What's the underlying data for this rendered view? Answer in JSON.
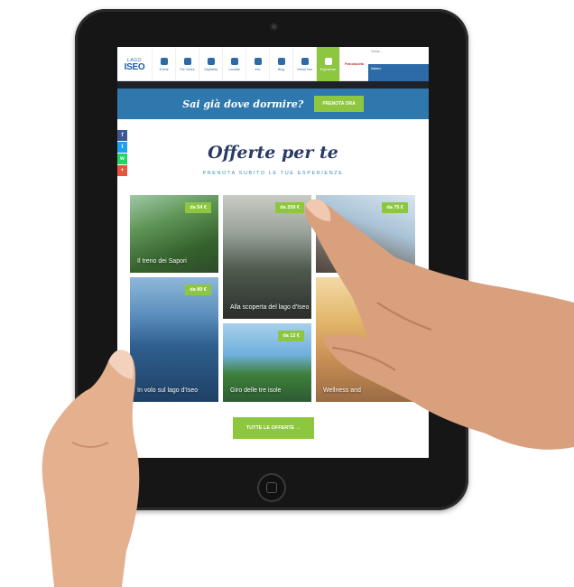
{
  "top_nav": {
    "logo_small": "LAGO",
    "logo_big": "ISEO",
    "items": [
      {
        "label": "Eventi",
        "icon": "calendar-icon"
      },
      {
        "label": "Per Vivere",
        "icon": "hotel-icon"
      },
      {
        "label": "Ospitalità",
        "icon": "bed-icon"
      },
      {
        "label": "Località",
        "icon": "camera-icon"
      },
      {
        "label": "Info",
        "icon": "info-icon"
      },
      {
        "label": "Blog",
        "icon": "blog-icon"
      },
      {
        "label": "Virtual Tour",
        "icon": "binoculars-icon"
      },
      {
        "label": "Esperienze",
        "icon": "hand-icon"
      }
    ],
    "active_index": 7,
    "brand": "Franciacorta",
    "search_placeholder": "Cerca...",
    "language": "Italiano"
  },
  "booking_bar": {
    "question": "Sai già dove dormire?",
    "button": "PRENOTA ORA"
  },
  "social": [
    {
      "label": "f",
      "icon": "facebook-icon"
    },
    {
      "label": "t",
      "icon": "twitter-icon"
    },
    {
      "label": "w",
      "icon": "whatsapp-icon"
    },
    {
      "label": "+",
      "icon": "googleplus-icon"
    }
  ],
  "offers": {
    "title": "Offerte per te",
    "subtitle": "PRENOTA SUBITO LE TUE ESPERIENZE",
    "tiles": [
      {
        "price": "da 54 €",
        "caption": "Il treno dei Sapori"
      },
      {
        "price": "da 259 €",
        "caption": "Alla scoperta del lago d'Iseo"
      },
      {
        "price": "da 75 €",
        "caption": ""
      },
      {
        "price": "da 80 €",
        "caption": "In volo sul lago d'Iseo"
      },
      {
        "price": "da 12 €",
        "caption": "Giro delle tre isole"
      },
      {
        "price": "",
        "caption": "Wellness and"
      }
    ],
    "cta": "TUTTE LE OFFERTE →"
  },
  "colors": {
    "accent_green": "#8dc63f",
    "bar_blue": "#2f78ad",
    "title_navy": "#2a3a66"
  }
}
